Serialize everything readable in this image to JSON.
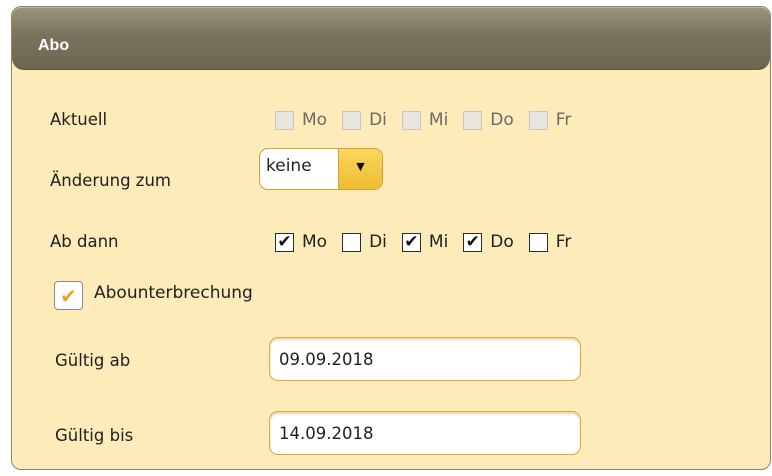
{
  "panel": {
    "title": "Abo"
  },
  "aktuell": {
    "label": "Aktuell",
    "days": [
      {
        "label": "Mo",
        "checked": false
      },
      {
        "label": "Di",
        "checked": false
      },
      {
        "label": "Mi",
        "checked": false
      },
      {
        "label": "Do",
        "checked": false
      },
      {
        "label": "Fr",
        "checked": false
      }
    ]
  },
  "aenderung": {
    "label": "Änderung zum",
    "value": "keine",
    "arrow_icon": "▼"
  },
  "ab_dann": {
    "label": "Ab dann",
    "days": [
      {
        "label": "Mo",
        "checked": true,
        "mark": "✔"
      },
      {
        "label": "Di",
        "checked": false,
        "mark": ""
      },
      {
        "label": "Mi",
        "checked": true,
        "mark": "✔"
      },
      {
        "label": "Do",
        "checked": true,
        "mark": "✔"
      },
      {
        "label": "Fr",
        "checked": false,
        "mark": ""
      }
    ]
  },
  "abounterbrechung": {
    "label": "Abounterbrechung",
    "checked": true,
    "mark": "✔"
  },
  "gueltig_ab": {
    "label": "Gültig ab",
    "value": "09.09.2018"
  },
  "gueltig_bis": {
    "label": "Gültig bis",
    "value": "14.09.2018"
  },
  "colors": {
    "panel_bg": "#fdebb9",
    "header_bg": "#7a745e",
    "accent": "#eebd32",
    "check_orange": "#f0a01c"
  }
}
